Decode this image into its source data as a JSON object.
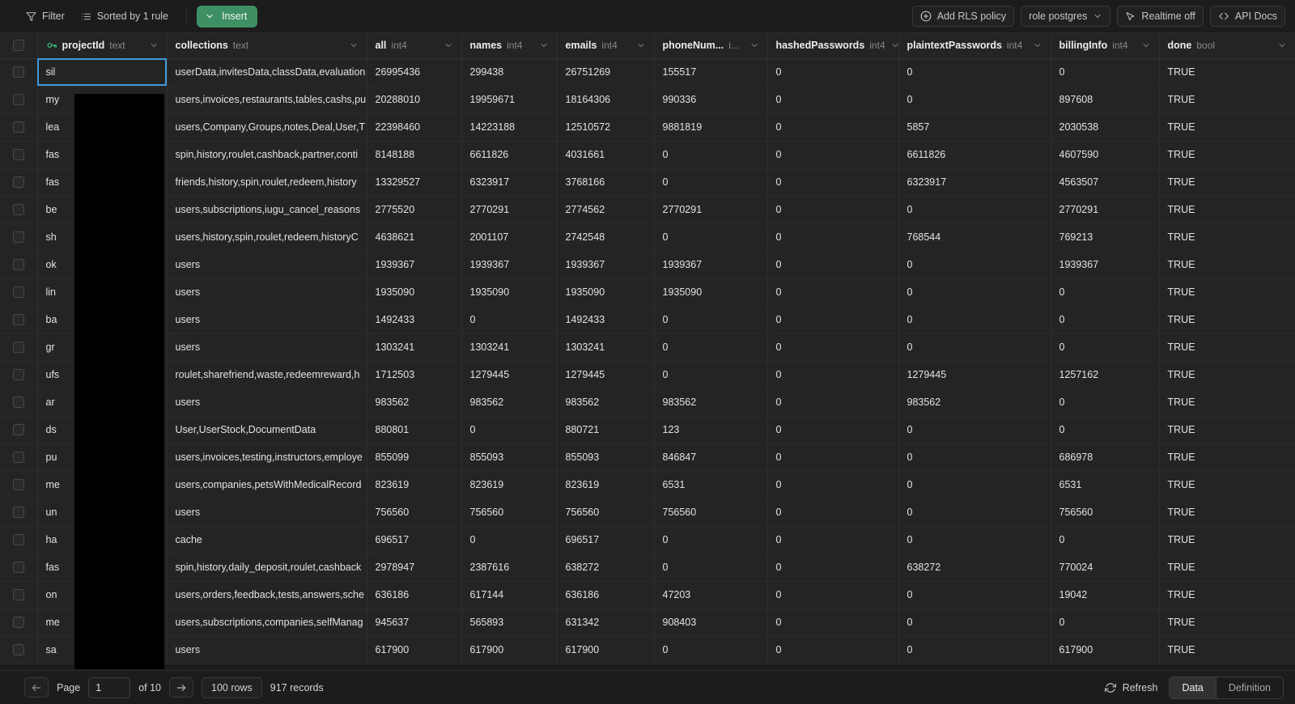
{
  "toolbar": {
    "filter_label": "Filter",
    "sort_label": "Sorted by 1 rule",
    "insert_label": "Insert",
    "add_rls_label": "Add RLS policy",
    "role_label": "role postgres",
    "realtime_label": "Realtime off",
    "api_docs_label": "API Docs"
  },
  "columns": [
    {
      "name": "projectId",
      "type": "text",
      "primary": true
    },
    {
      "name": "collections",
      "type": "text",
      "primary": false
    },
    {
      "name": "all",
      "type": "int4",
      "primary": false
    },
    {
      "name": "names",
      "type": "int4",
      "primary": false
    },
    {
      "name": "emails",
      "type": "int4",
      "primary": false
    },
    {
      "name": "phoneNum...",
      "type": "i...",
      "primary": false
    },
    {
      "name": "hashedPasswords",
      "type": "int4",
      "primary": false
    },
    {
      "name": "plaintextPasswords",
      "type": "int4",
      "primary": false
    },
    {
      "name": "billingInfo",
      "type": "int4",
      "primary": false
    },
    {
      "name": "done",
      "type": "bool",
      "primary": false
    }
  ],
  "rows": [
    {
      "projectId": "sil",
      "collections": "userData,invitesData,classData,evaluation",
      "all": "26995436",
      "names": "299438",
      "emails": "26751269",
      "phoneNumbers": "155517",
      "hashedPasswords": "0",
      "plaintextPasswords": "0",
      "billingInfo": "0",
      "done": "TRUE",
      "selected": true
    },
    {
      "projectId": "my",
      "collections": "users,invoices,restaurants,tables,cashs,pu",
      "all": "20288010",
      "names": "19959671",
      "emails": "18164306",
      "phoneNumbers": "990336",
      "hashedPasswords": "0",
      "plaintextPasswords": "0",
      "billingInfo": "897608",
      "done": "TRUE",
      "selected": false
    },
    {
      "projectId": "lea",
      "collections": "users,Company,Groups,notes,Deal,User,T",
      "all": "22398460",
      "names": "14223188",
      "emails": "12510572",
      "phoneNumbers": "9881819",
      "hashedPasswords": "0",
      "plaintextPasswords": "5857",
      "billingInfo": "2030538",
      "done": "TRUE",
      "selected": false
    },
    {
      "projectId": "fas",
      "collections": "spin,history,roulet,cashback,partner,conti",
      "all": "8148188",
      "names": "6611826",
      "emails": "4031661",
      "phoneNumbers": "0",
      "hashedPasswords": "0",
      "plaintextPasswords": "6611826",
      "billingInfo": "4607590",
      "done": "TRUE",
      "selected": false
    },
    {
      "projectId": "fas",
      "collections": "friends,history,spin,roulet,redeem,history",
      "all": "13329527",
      "names": "6323917",
      "emails": "3768166",
      "phoneNumbers": "0",
      "hashedPasswords": "0",
      "plaintextPasswords": "6323917",
      "billingInfo": "4563507",
      "done": "TRUE",
      "selected": false
    },
    {
      "projectId": "be",
      "collections": "users,subscriptions,iugu_cancel_reasons",
      "all": "2775520",
      "names": "2770291",
      "emails": "2774562",
      "phoneNumbers": "2770291",
      "hashedPasswords": "0",
      "plaintextPasswords": "0",
      "billingInfo": "2770291",
      "done": "TRUE",
      "selected": false
    },
    {
      "projectId": "sh",
      "collections": "users,history,spin,roulet,redeem,historyC",
      "all": "4638621",
      "names": "2001107",
      "emails": "2742548",
      "phoneNumbers": "0",
      "hashedPasswords": "0",
      "plaintextPasswords": "768544",
      "billingInfo": "769213",
      "done": "TRUE",
      "selected": false
    },
    {
      "projectId": "ok",
      "collections": "users",
      "all": "1939367",
      "names": "1939367",
      "emails": "1939367",
      "phoneNumbers": "1939367",
      "hashedPasswords": "0",
      "plaintextPasswords": "0",
      "billingInfo": "1939367",
      "done": "TRUE",
      "selected": false
    },
    {
      "projectId": "lin",
      "collections": "users",
      "all": "1935090",
      "names": "1935090",
      "emails": "1935090",
      "phoneNumbers": "1935090",
      "hashedPasswords": "0",
      "plaintextPasswords": "0",
      "billingInfo": "0",
      "done": "TRUE",
      "selected": false
    },
    {
      "projectId": "ba",
      "collections": "users",
      "all": "1492433",
      "names": "0",
      "emails": "1492433",
      "phoneNumbers": "0",
      "hashedPasswords": "0",
      "plaintextPasswords": "0",
      "billingInfo": "0",
      "done": "TRUE",
      "selected": false
    },
    {
      "projectId": "gr",
      "collections": "users",
      "all": "1303241",
      "names": "1303241",
      "emails": "1303241",
      "phoneNumbers": "0",
      "hashedPasswords": "0",
      "plaintextPasswords": "0",
      "billingInfo": "0",
      "done": "TRUE",
      "selected": false
    },
    {
      "projectId": "ufs",
      "collections": "roulet,sharefriend,waste,redeemreward,h",
      "all": "1712503",
      "names": "1279445",
      "emails": "1279445",
      "phoneNumbers": "0",
      "hashedPasswords": "0",
      "plaintextPasswords": "1279445",
      "billingInfo": "1257162",
      "done": "TRUE",
      "selected": false
    },
    {
      "projectId": "ar",
      "collections": "users",
      "all": "983562",
      "names": "983562",
      "emails": "983562",
      "phoneNumbers": "983562",
      "hashedPasswords": "0",
      "plaintextPasswords": "983562",
      "billingInfo": "0",
      "done": "TRUE",
      "selected": false
    },
    {
      "projectId": "ds",
      "collections": "User,UserStock,DocumentData",
      "all": "880801",
      "names": "0",
      "emails": "880721",
      "phoneNumbers": "123",
      "hashedPasswords": "0",
      "plaintextPasswords": "0",
      "billingInfo": "0",
      "done": "TRUE",
      "selected": false
    },
    {
      "projectId": "pu",
      "collections": "users,invoices,testing,instructors,employe",
      "all": "855099",
      "names": "855093",
      "emails": "855093",
      "phoneNumbers": "846847",
      "hashedPasswords": "0",
      "plaintextPasswords": "0",
      "billingInfo": "686978",
      "done": "TRUE",
      "selected": false
    },
    {
      "projectId": "me",
      "collections": "users,companies,petsWithMedicalRecord",
      "all": "823619",
      "names": "823619",
      "emails": "823619",
      "phoneNumbers": "6531",
      "hashedPasswords": "0",
      "plaintextPasswords": "0",
      "billingInfo": "6531",
      "done": "TRUE",
      "selected": false
    },
    {
      "projectId": "un",
      "collections": "users",
      "all": "756560",
      "names": "756560",
      "emails": "756560",
      "phoneNumbers": "756560",
      "hashedPasswords": "0",
      "plaintextPasswords": "0",
      "billingInfo": "756560",
      "done": "TRUE",
      "selected": false
    },
    {
      "projectId": "ha",
      "collections": "cache",
      "all": "696517",
      "names": "0",
      "emails": "696517",
      "phoneNumbers": "0",
      "hashedPasswords": "0",
      "plaintextPasswords": "0",
      "billingInfo": "0",
      "done": "TRUE",
      "selected": false
    },
    {
      "projectId": "fas",
      "collections": "spin,history,daily_deposit,roulet,cashback",
      "all": "2978947",
      "names": "2387616",
      "emails": "638272",
      "phoneNumbers": "0",
      "hashedPasswords": "0",
      "plaintextPasswords": "638272",
      "billingInfo": "770024",
      "done": "TRUE",
      "selected": false
    },
    {
      "projectId": "on",
      "collections": "users,orders,feedback,tests,answers,sche",
      "all": "636186",
      "names": "617144",
      "emails": "636186",
      "phoneNumbers": "47203",
      "hashedPasswords": "0",
      "plaintextPasswords": "0",
      "billingInfo": "19042",
      "done": "TRUE",
      "selected": false
    },
    {
      "projectId": "me",
      "collections": "users,subscriptions,companies,selfManag",
      "all": "945637",
      "names": "565893",
      "emails": "631342",
      "phoneNumbers": "908403",
      "hashedPasswords": "0",
      "plaintextPasswords": "0",
      "billingInfo": "0",
      "done": "TRUE",
      "selected": false
    },
    {
      "projectId": "sa",
      "collections": "users",
      "all": "617900",
      "names": "617900",
      "emails": "617900",
      "phoneNumbers": "0",
      "hashedPasswords": "0",
      "plaintextPasswords": "0",
      "billingInfo": "617900",
      "done": "TRUE",
      "selected": false
    }
  ],
  "footer": {
    "page_label": "Page",
    "page_value": "1",
    "page_total": "of 10",
    "rows_per_page": "100 rows",
    "records": "917 records",
    "refresh_label": "Refresh",
    "tab_data": "Data",
    "tab_definition": "Definition"
  },
  "colors": {
    "accent_green": "#3e8f63",
    "selection_blue": "#3e9bdd",
    "key_green": "#3ecf8e"
  }
}
